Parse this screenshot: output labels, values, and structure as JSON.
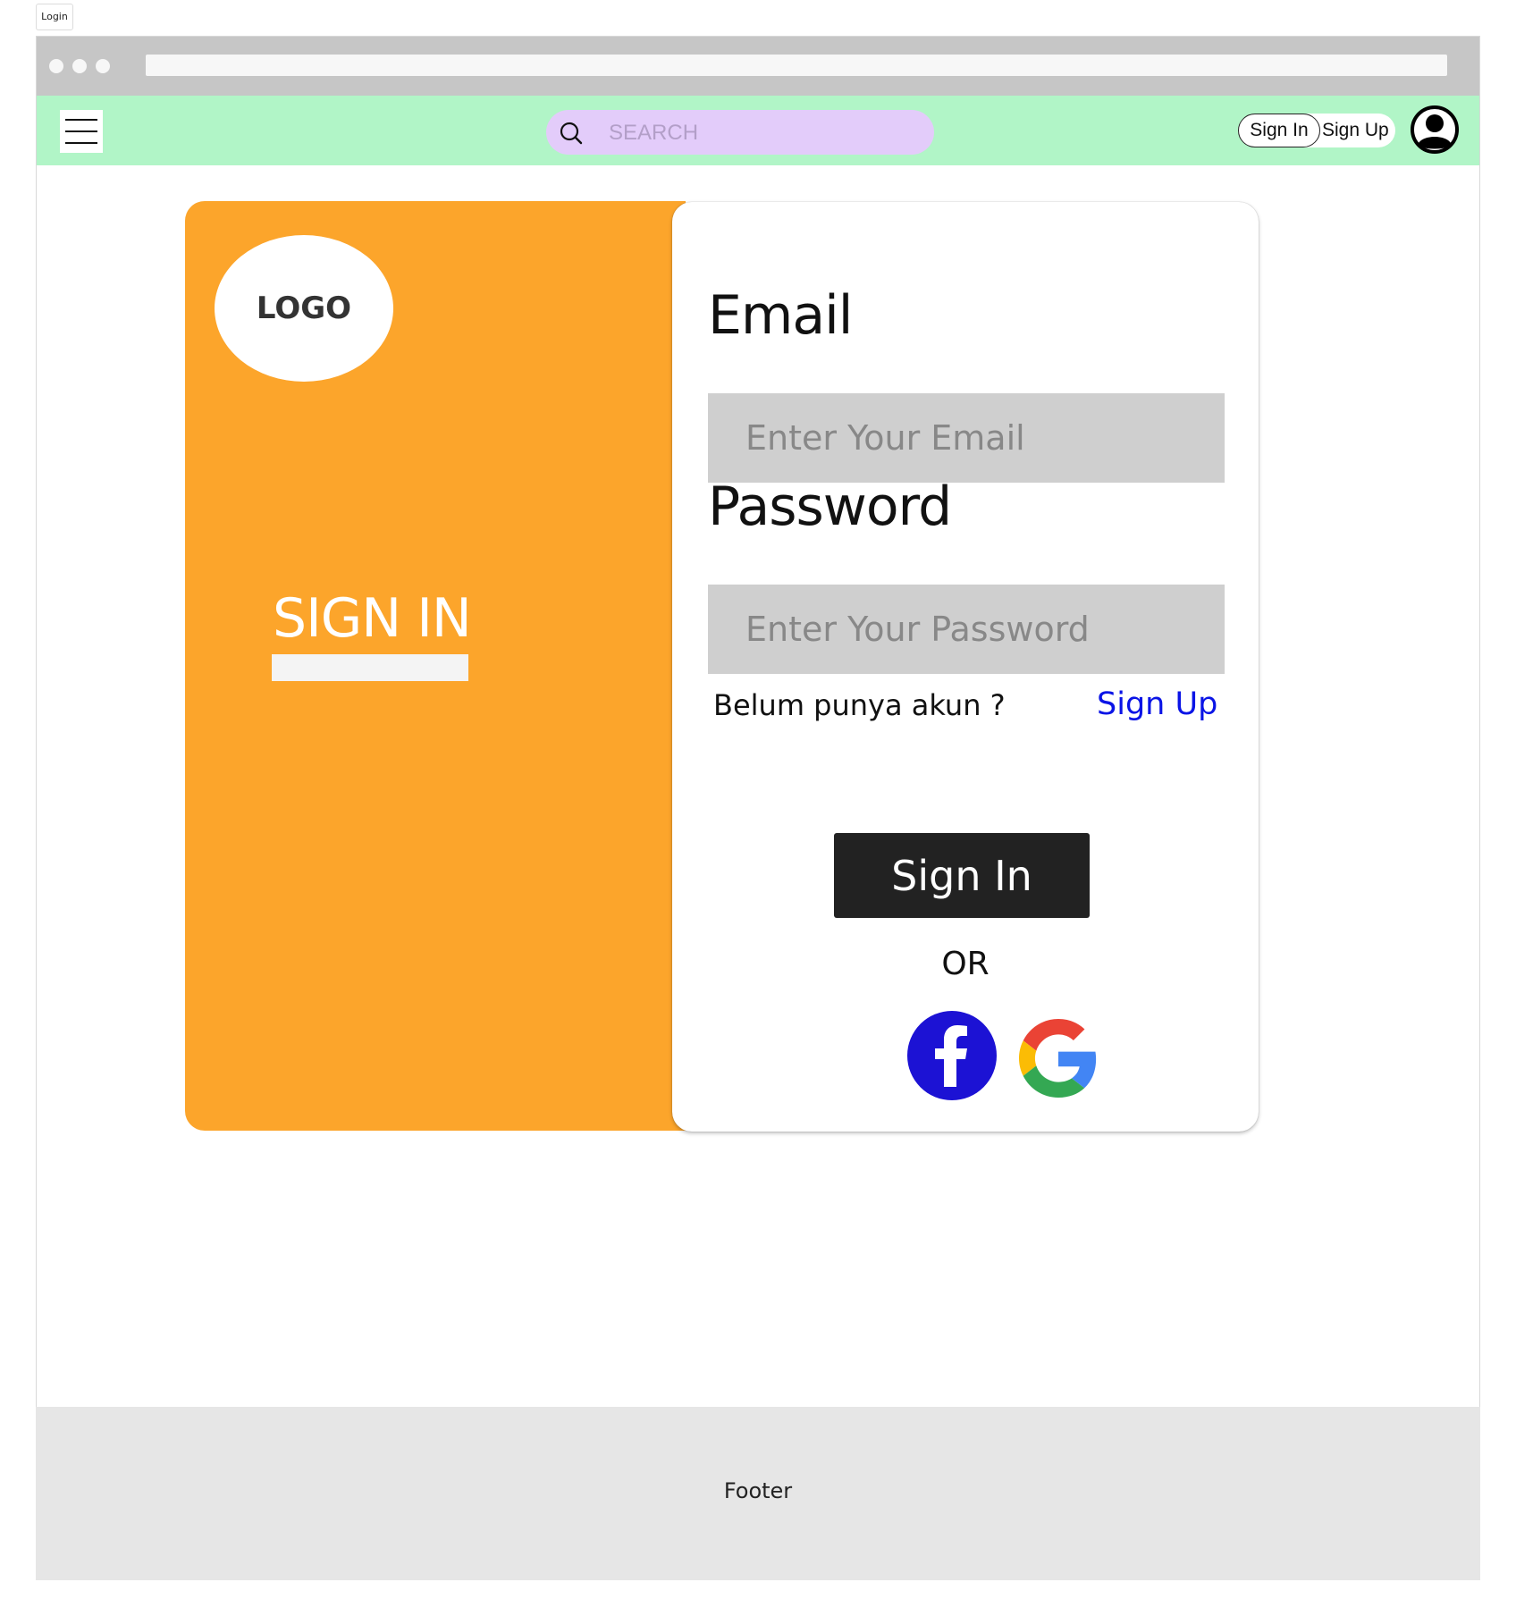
{
  "frame": {
    "label": "Login"
  },
  "header": {
    "search": {
      "placeholder": "SEARCH"
    },
    "sign_in_label": "Sign In",
    "sign_up_label": "Sign Up"
  },
  "brand": {
    "logo_text": "LOGO"
  },
  "side_panel": {
    "title": "SIGN IN"
  },
  "form": {
    "email_label": "Email",
    "email_placeholder": "Enter Your Email",
    "password_label": "Password",
    "password_placeholder": "Enter Your Password",
    "no_account_text": "Belum punya akun ?",
    "sign_up_link": "Sign Up",
    "submit_label": "Sign In",
    "or_text": "OR"
  },
  "footer": {
    "text": "Footer"
  },
  "colors": {
    "navbar": "#b1f5c7",
    "search": "#e3ccfa",
    "side_panel": "#fca52b",
    "link": "#0a14e6",
    "facebook": "#1c12d4",
    "button": "#222222"
  },
  "icons": {
    "menu": "hamburger-icon",
    "search": "search-icon",
    "avatar": "user-avatar-icon",
    "facebook": "facebook-icon",
    "google": "google-icon"
  }
}
